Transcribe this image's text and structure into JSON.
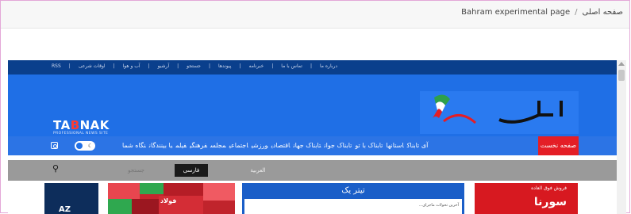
{
  "breadcrumb": {
    "home": "صفحه اصلی",
    "separator": "/",
    "current": "Bahram experimental page"
  },
  "site": {
    "top_links": [
      "درباره ما",
      "تماس با ما",
      "خبرنامه",
      "پیوندها",
      "جستجو",
      "آرشیو",
      "آب و هوا",
      "اوقات شرعی",
      "RSS"
    ],
    "logo_text_pre": "TA",
    "logo_text_accent": "B",
    "logo_text_post": "NAK",
    "logo_sub": "PROFESSIONAL NEWS SITE",
    "nav_home": "صفحه نخست",
    "nav_items": [
      "آی تابناک",
      "استانها",
      "تابناک با تو",
      "تابناک جوان",
      "تابناک جهان",
      "اقتصادی",
      "ورزشی",
      "اجتماعی",
      "مجلس",
      "فرهنگی",
      "فیلم",
      "با بینندگان",
      "نگاه شما"
    ],
    "search_placeholder": "جستجو",
    "lang_fa": "فارسی",
    "lang_ar": "العربیة",
    "news_title": "تیتر یک",
    "news_line": "آخرین تحولات ماجرای...",
    "market_label": "فولاد",
    "ad_line1": "فروش فوق العاده",
    "ad_line2": "سورنا",
    "dark_card_label": "AZ"
  },
  "icons": {
    "search": "search-icon",
    "moon": "moon-icon",
    "instagram": "instagram-icon",
    "scroll_up": "scroll-up-arrow-icon"
  },
  "colors": {
    "top_bar": "#0a3f8c",
    "header": "#1f6fe6",
    "nav_home": "#e41e26",
    "search_bar": "#9a9a9a"
  }
}
